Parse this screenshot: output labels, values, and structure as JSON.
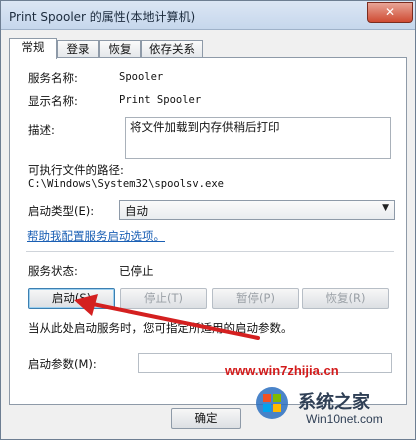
{
  "window": {
    "title": "Print Spooler 的属性(本地计算机)",
    "close_glyph": "✕"
  },
  "tabs": [
    {
      "label": "常规",
      "active": true
    },
    {
      "label": "登录",
      "active": false
    },
    {
      "label": "恢复",
      "active": false
    },
    {
      "label": "依存关系",
      "active": false
    }
  ],
  "general": {
    "service_name_label": "服务名称:",
    "service_name_value": "Spooler",
    "display_name_label": "显示名称:",
    "display_name_value": "Print Spooler",
    "description_label": "描述:",
    "description_value": "将文件加载到内存供稍后打印",
    "path_label": "可执行文件的路径:",
    "path_value": "C:\\Windows\\System32\\spoolsv.exe",
    "startup_type_label": "启动类型(E):",
    "startup_type_value": "自动",
    "help_link": "帮助我配置服务启动选项。",
    "status_label": "服务状态:",
    "status_value": "已停止",
    "buttons": {
      "start": "启动(S)",
      "stop": "停止(T)",
      "pause": "暂停(P)",
      "resume": "恢复(R)"
    },
    "hint": "当从此处启动服务时，您可指定所适用的启动参数。",
    "params_label": "启动参数(M):",
    "params_value": ""
  },
  "footer": {
    "ok": "确定"
  },
  "watermark": {
    "url": "www.win7zhijia.cn",
    "brand": "系统之家",
    "sub": "Win10net.com"
  },
  "colors": {
    "arrow": "#d42020",
    "link": "#1a5fb4",
    "watermark_red": "#d31b1b"
  },
  "icons": {
    "close": "close-icon",
    "dropdown": "chevron-down-icon",
    "logo": "windows-logo-icon"
  }
}
